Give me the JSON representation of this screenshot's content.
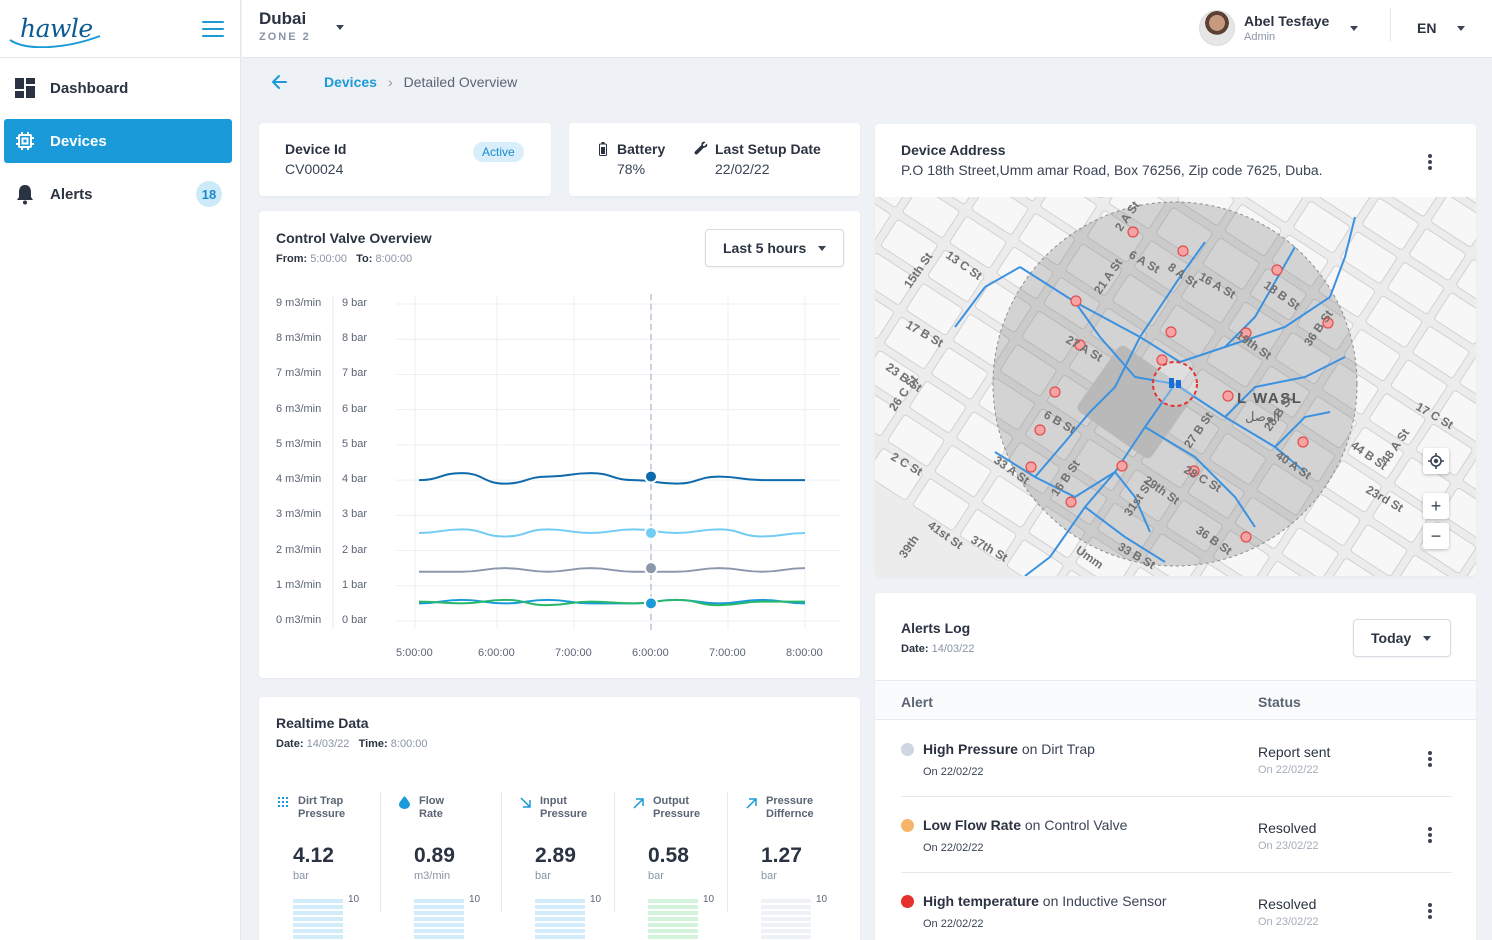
{
  "brand": {
    "logo_text": "hawle"
  },
  "sidebar": {
    "items": [
      {
        "label": "Dashboard",
        "icon": "dashboard-icon"
      },
      {
        "label": "Devices",
        "icon": "chip-icon",
        "active": true
      },
      {
        "label": "Alerts",
        "icon": "bell-icon",
        "badge": "18"
      }
    ]
  },
  "topbar": {
    "city": "Dubai",
    "zone": "ZONE 2",
    "user_name": "Abel Tesfaye",
    "user_role": "Admin",
    "language": "EN"
  },
  "breadcrumb": {
    "link": "Devices",
    "current": "Detailed Overview"
  },
  "device": {
    "id_label": "Device Id",
    "id_value": "CV00024",
    "status": "Active"
  },
  "battery": {
    "label": "Battery",
    "value": "78%",
    "setup_label": "Last Setup Date",
    "setup_value": "22/02/22"
  },
  "overview": {
    "title": "Control Valve Overview",
    "from_label": "From:",
    "from_value": "5:00:00",
    "to_label": "To:",
    "to_value": "8:00:00",
    "range": "Last 5 hours"
  },
  "chart_data": {
    "type": "line",
    "title": "Control Valve Overview",
    "x": [
      "5:00:00",
      "6:00:00",
      "7:00:00",
      "6:00:00",
      "7:00:00",
      "8:00:00"
    ],
    "y_left_ticks": [
      "0 m3/min",
      "1 m3/min",
      "2 m3/min",
      "3 m3/min",
      "4 m3/min",
      "5 m3/min",
      "6 m3/min",
      "7 m3/min",
      "8 m3/min",
      "9 m3/min"
    ],
    "y_right_ticks": [
      "0 bar",
      "1 bar",
      "2 bar",
      "3 bar",
      "4 bar",
      "5 bar",
      "6 bar",
      "7 bar",
      "8 bar",
      "9 bar"
    ],
    "ylim": [
      0,
      9
    ],
    "grid": true,
    "cursor_x_index": 3,
    "series": [
      {
        "color": "#0e6aab",
        "values": [
          4.0,
          4.2,
          3.9,
          4.1,
          4.2,
          4.0,
          3.9,
          4.1,
          4.0,
          4.0
        ],
        "marker": 4.1
      },
      {
        "color": "#72ccf3",
        "values": [
          2.5,
          2.6,
          2.4,
          2.6,
          2.5,
          2.6,
          2.5,
          2.6,
          2.4,
          2.5
        ],
        "marker": 2.5
      },
      {
        "color": "#8b98ac",
        "values": [
          1.4,
          1.4,
          1.5,
          1.4,
          1.5,
          1.4,
          1.4,
          1.5,
          1.4,
          1.5
        ],
        "marker": 1.5
      },
      {
        "color": "#1a9ad8",
        "values": [
          0.5,
          0.6,
          0.5,
          0.6,
          0.5,
          0.5,
          0.6,
          0.5,
          0.6,
          0.5
        ],
        "marker": 0.5
      },
      {
        "color": "#27b86b",
        "values": [
          0.55,
          0.5,
          0.6,
          0.45,
          0.55,
          0.5,
          0.6,
          0.45,
          0.55,
          0.55
        ]
      }
    ]
  },
  "realtime": {
    "title": "Realtime Data",
    "date_label": "Date:",
    "date_value": "14/03/22",
    "time_label": "Time:",
    "time_value": "8:00:00",
    "items": [
      {
        "label_1": "Dirt Trap",
        "label_2": "Pressure",
        "value": "4.12",
        "unit": "bar",
        "max": "10",
        "icon": "dots-grid-icon",
        "level": 0.4,
        "bar_color": "#d3ecfa"
      },
      {
        "label_1": "Flow",
        "label_2": "Rate",
        "value": "0.89",
        "unit": "m3/min",
        "max": "10",
        "icon": "water-drop-icon",
        "level": 0.1,
        "bar_color": "#d3ecfa"
      },
      {
        "label_1": "Input",
        "label_2": "Pressure",
        "value": "2.89",
        "unit": "bar",
        "max": "10",
        "icon": "arrow-down-right-icon",
        "level": 0.3,
        "bar_color": "#d3ecfa"
      },
      {
        "label_1": "Output",
        "label_2": "Pressure",
        "value": "0.58",
        "unit": "bar",
        "max": "10",
        "icon": "arrow-up-right-icon",
        "level": 0.1,
        "bar_color": "#d4f3dc"
      },
      {
        "label_1": "Pressure",
        "label_2": "Differnce",
        "value": "1.27",
        "unit": "bar",
        "max": "10",
        "icon": "arrow-up-right-icon",
        "level": 0.1,
        "bar_color": "#eef1f5"
      }
    ]
  },
  "address": {
    "title": "Device Address",
    "value": "P.O 18th Street,Umm amar Road, Box 76256, Zip code 7625, Duba."
  },
  "map": {
    "area_label": "L WASL",
    "area_label_ar": "الوصل",
    "zoom_in": "+",
    "zoom_out": "−",
    "streets": [
      "13 C St",
      "15th St",
      "17 B St",
      "23 B St",
      "26 C St",
      "2 C St",
      "41st St",
      "39th",
      "37th St",
      "33 A St",
      "16 B St",
      "6 A St",
      "8 A St",
      "2 A St",
      "16 A St",
      "18 B St",
      "21 A St",
      "27 A St",
      "19th St",
      "36 B St",
      "17 C St",
      "44 B St",
      "48 A St",
      "23rd St",
      "40 A St",
      "27 B St",
      "28 C St",
      "29th St",
      "31st St",
      "33 B St",
      "36 B St",
      "28 B St",
      "6 B St",
      "Umm"
    ]
  },
  "alerts": {
    "title": "Alerts Log",
    "date_label": "Date:",
    "date_value": "14/03/22",
    "range": "Today",
    "col_alert": "Alert",
    "col_status": "Status",
    "rows": [
      {
        "bold": "High Pressure",
        "rest": " on Dirt Trap",
        "date": "On 22/02/22",
        "status": "Report sent",
        "status_date": "On 22/02/22",
        "color": "#cfd6e1"
      },
      {
        "bold": "Low Flow Rate",
        "rest": " on Control Valve",
        "date": "On 22/02/22",
        "status": "Resolved",
        "status_date": "On 23/02/22",
        "color": "#f5b56b"
      },
      {
        "bold": "High temperature",
        "rest": " on Inductive Sensor",
        "date": "On 22/02/22",
        "status": "Resolved",
        "status_date": "On 23/02/22",
        "color": "#e5312e"
      }
    ]
  }
}
